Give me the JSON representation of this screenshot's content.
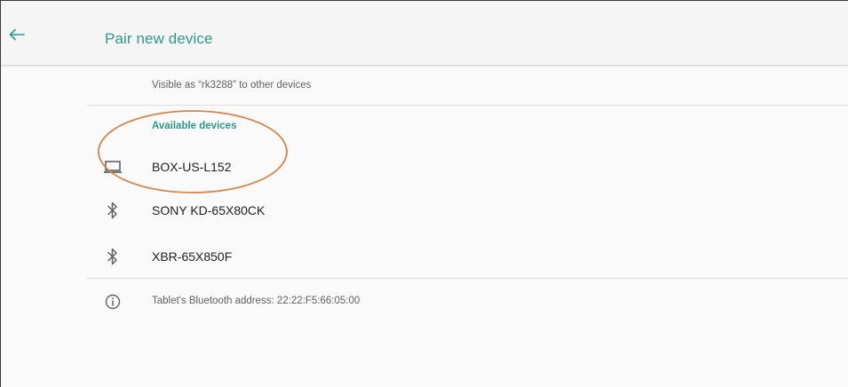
{
  "header": {
    "title": "Pair new device",
    "back_icon": "arrow-left-icon"
  },
  "visible_as": "Visible as “rk3288” to other devices",
  "available_section": {
    "header": "Available devices",
    "devices": [
      {
        "label": "BOX-US-L152",
        "icon": "laptop-icon"
      },
      {
        "label": "SONY KD-65X80CK",
        "icon": "bluetooth-icon"
      },
      {
        "label": "XBR-65X850F",
        "icon": "bluetooth-icon"
      }
    ]
  },
  "info": {
    "icon": "info-icon",
    "text": "Tablet's Bluetooth address: 22:22:F5:66:05:00"
  },
  "colors": {
    "accent": "#2b9a8a",
    "annotation": "#d9854a",
    "icon": "#5f6368"
  }
}
